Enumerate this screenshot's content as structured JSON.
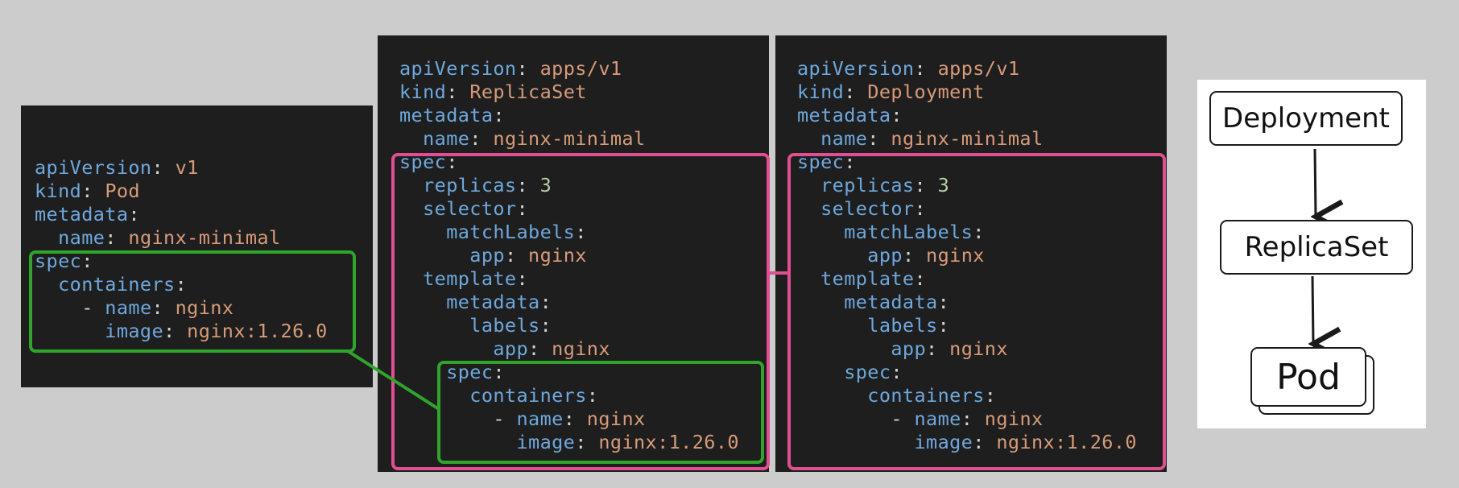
{
  "pod_yaml": [
    [
      {
        "t": "apiVersion",
        "c": "k"
      },
      {
        "t": ": ",
        "c": "p"
      },
      {
        "t": "v1",
        "c": "v"
      }
    ],
    [
      {
        "t": "kind",
        "c": "k"
      },
      {
        "t": ": ",
        "c": "p"
      },
      {
        "t": "Pod",
        "c": "v"
      }
    ],
    [
      {
        "t": "metadata",
        "c": "k"
      },
      {
        "t": ":",
        "c": "p"
      }
    ],
    [
      {
        "t": "  name",
        "c": "k"
      },
      {
        "t": ": ",
        "c": "p"
      },
      {
        "t": "nginx-minimal",
        "c": "v"
      }
    ],
    [
      {
        "t": "spec",
        "c": "k"
      },
      {
        "t": ":",
        "c": "p"
      }
    ],
    [
      {
        "t": "  containers",
        "c": "k"
      },
      {
        "t": ":",
        "c": "p"
      }
    ],
    [
      {
        "t": "    - ",
        "c": "p"
      },
      {
        "t": "name",
        "c": "k"
      },
      {
        "t": ": ",
        "c": "p"
      },
      {
        "t": "nginx",
        "c": "v"
      }
    ],
    [
      {
        "t": "      image",
        "c": "k"
      },
      {
        "t": ": ",
        "c": "p"
      },
      {
        "t": "nginx:1.26.0",
        "c": "v"
      }
    ]
  ],
  "replicaset_yaml": [
    [
      {
        "t": "apiVersion",
        "c": "k"
      },
      {
        "t": ": ",
        "c": "p"
      },
      {
        "t": "apps/v1",
        "c": "v"
      }
    ],
    [
      {
        "t": "kind",
        "c": "k"
      },
      {
        "t": ": ",
        "c": "p"
      },
      {
        "t": "ReplicaSet",
        "c": "v"
      }
    ],
    [
      {
        "t": "metadata",
        "c": "k"
      },
      {
        "t": ":",
        "c": "p"
      }
    ],
    [
      {
        "t": "  name",
        "c": "k"
      },
      {
        "t": ": ",
        "c": "p"
      },
      {
        "t": "nginx-minimal",
        "c": "v"
      }
    ],
    [
      {
        "t": "spec",
        "c": "k"
      },
      {
        "t": ":",
        "c": "p"
      }
    ],
    [
      {
        "t": "  replicas",
        "c": "k"
      },
      {
        "t": ": ",
        "c": "p"
      },
      {
        "t": "3",
        "c": "n"
      }
    ],
    [
      {
        "t": "  selector",
        "c": "k"
      },
      {
        "t": ":",
        "c": "p"
      }
    ],
    [
      {
        "t": "    matchLabels",
        "c": "k"
      },
      {
        "t": ":",
        "c": "p"
      }
    ],
    [
      {
        "t": "      app",
        "c": "k"
      },
      {
        "t": ": ",
        "c": "p"
      },
      {
        "t": "nginx",
        "c": "v"
      }
    ],
    [
      {
        "t": "  template",
        "c": "k"
      },
      {
        "t": ":",
        "c": "p"
      }
    ],
    [
      {
        "t": "    metadata",
        "c": "k"
      },
      {
        "t": ":",
        "c": "p"
      }
    ],
    [
      {
        "t": "      labels",
        "c": "k"
      },
      {
        "t": ":",
        "c": "p"
      }
    ],
    [
      {
        "t": "        app",
        "c": "k"
      },
      {
        "t": ": ",
        "c": "p"
      },
      {
        "t": "nginx",
        "c": "v"
      }
    ],
    [
      {
        "t": "    spec",
        "c": "k"
      },
      {
        "t": ":",
        "c": "p"
      }
    ],
    [
      {
        "t": "      containers",
        "c": "k"
      },
      {
        "t": ":",
        "c": "p"
      }
    ],
    [
      {
        "t": "        - ",
        "c": "p"
      },
      {
        "t": "name",
        "c": "k"
      },
      {
        "t": ": ",
        "c": "p"
      },
      {
        "t": "nginx",
        "c": "v"
      }
    ],
    [
      {
        "t": "          image",
        "c": "k"
      },
      {
        "t": ": ",
        "c": "p"
      },
      {
        "t": "nginx:1.26.0",
        "c": "v"
      }
    ]
  ],
  "deployment_yaml": [
    [
      {
        "t": "apiVersion",
        "c": "k"
      },
      {
        "t": ": ",
        "c": "p"
      },
      {
        "t": "apps/v1",
        "c": "v"
      }
    ],
    [
      {
        "t": "kind",
        "c": "k"
      },
      {
        "t": ": ",
        "c": "p"
      },
      {
        "t": "Deployment",
        "c": "v"
      }
    ],
    [
      {
        "t": "metadata",
        "c": "k"
      },
      {
        "t": ":",
        "c": "p"
      }
    ],
    [
      {
        "t": "  name",
        "c": "k"
      },
      {
        "t": ": ",
        "c": "p"
      },
      {
        "t": "nginx-minimal",
        "c": "v"
      }
    ],
    [
      {
        "t": "spec",
        "c": "k"
      },
      {
        "t": ":",
        "c": "p"
      }
    ],
    [
      {
        "t": "  replicas",
        "c": "k"
      },
      {
        "t": ": ",
        "c": "p"
      },
      {
        "t": "3",
        "c": "n"
      }
    ],
    [
      {
        "t": "  selector",
        "c": "k"
      },
      {
        "t": ":",
        "c": "p"
      }
    ],
    [
      {
        "t": "    matchLabels",
        "c": "k"
      },
      {
        "t": ":",
        "c": "p"
      }
    ],
    [
      {
        "t": "      app",
        "c": "k"
      },
      {
        "t": ": ",
        "c": "p"
      },
      {
        "t": "nginx",
        "c": "v"
      }
    ],
    [
      {
        "t": "  template",
        "c": "k"
      },
      {
        "t": ":",
        "c": "p"
      }
    ],
    [
      {
        "t": "    metadata",
        "c": "k"
      },
      {
        "t": ":",
        "c": "p"
      }
    ],
    [
      {
        "t": "      labels",
        "c": "k"
      },
      {
        "t": ":",
        "c": "p"
      }
    ],
    [
      {
        "t": "        app",
        "c": "k"
      },
      {
        "t": ": ",
        "c": "p"
      },
      {
        "t": "nginx",
        "c": "v"
      }
    ],
    [
      {
        "t": "    spec",
        "c": "k"
      },
      {
        "t": ":",
        "c": "p"
      }
    ],
    [
      {
        "t": "      containers",
        "c": "k"
      },
      {
        "t": ":",
        "c": "p"
      }
    ],
    [
      {
        "t": "        - ",
        "c": "p"
      },
      {
        "t": "name",
        "c": "k"
      },
      {
        "t": ": ",
        "c": "p"
      },
      {
        "t": "nginx",
        "c": "v"
      }
    ],
    [
      {
        "t": "          image",
        "c": "k"
      },
      {
        "t": ": ",
        "c": "p"
      },
      {
        "t": "nginx:1.26.0",
        "c": "v"
      }
    ]
  ],
  "hierarchy": {
    "deployment": "Deployment",
    "replicaset": "ReplicaSet",
    "pod": "Pod"
  },
  "colors": {
    "panel_bg": "#1e1e1e",
    "key": "#6ea8dd",
    "value": "#d89b7a",
    "number": "#b5cea8",
    "pod_spec_highlight": "#2fa62a",
    "controller_spec_highlight": "#e04f91"
  }
}
